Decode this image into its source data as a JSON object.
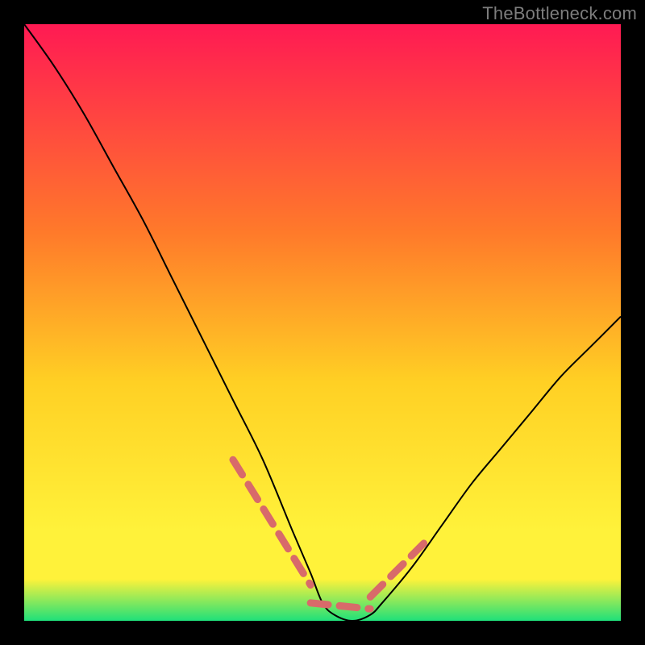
{
  "watermark": "TheBottleneck.com",
  "colors": {
    "gradient_top": "#ff1a53",
    "gradient_upper_mid": "#ff7a2a",
    "gradient_mid": "#ffd024",
    "gradient_lower_mid": "#fff23a",
    "gradient_bottom": "#1fe07a",
    "curve": "#000000",
    "dash_accent": "#d86a6a",
    "frame": "#000000"
  },
  "chart_data": {
    "type": "line",
    "title": "",
    "xlabel": "",
    "ylabel": "",
    "xlim": [
      0,
      100
    ],
    "ylim": [
      0,
      100
    ],
    "series": [
      {
        "name": "bottleneck-curve",
        "x": [
          0,
          5,
          10,
          15,
          20,
          25,
          30,
          35,
          40,
          45,
          48,
          50,
          52,
          55,
          58,
          60,
          65,
          70,
          75,
          80,
          85,
          90,
          95,
          100
        ],
        "y": [
          100,
          93,
          85,
          76,
          67,
          57,
          47,
          37,
          27,
          15,
          8,
          3,
          1,
          0,
          1,
          3,
          9,
          16,
          23,
          29,
          35,
          41,
          46,
          51
        ]
      }
    ],
    "accent_dashes": {
      "left": {
        "x_range": [
          35,
          48
        ],
        "y_range": [
          27,
          6
        ]
      },
      "floor": {
        "x_range": [
          48,
          58
        ],
        "y_range": [
          3,
          2
        ]
      },
      "right": {
        "x_range": [
          58,
          68
        ],
        "y_range": [
          4,
          14
        ]
      }
    }
  }
}
